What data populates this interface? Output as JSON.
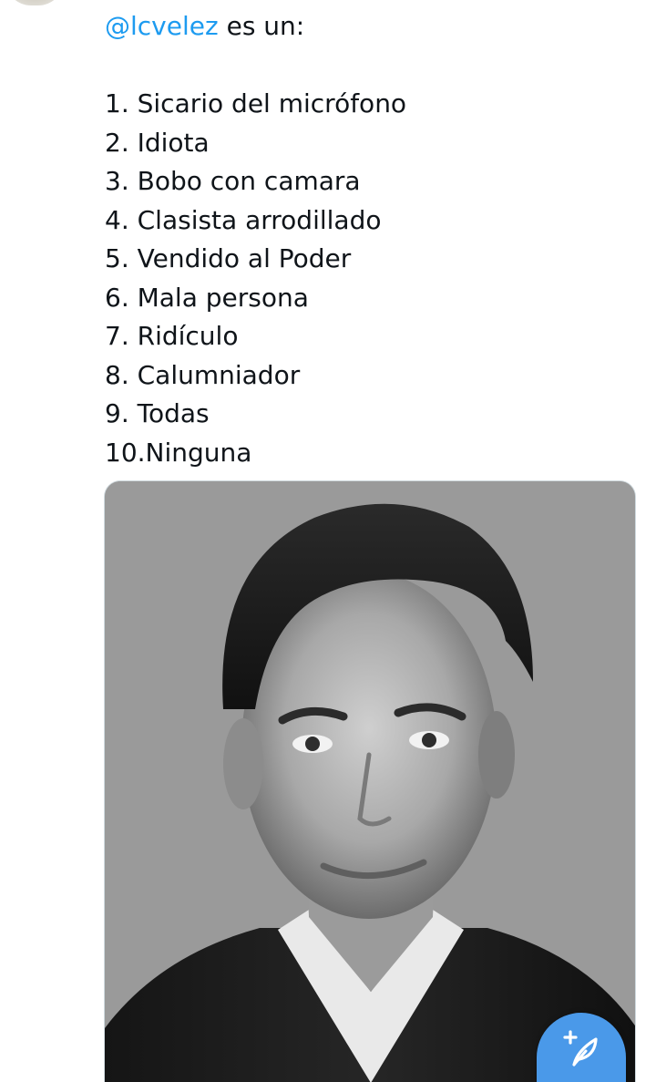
{
  "tweet": {
    "mention": "@lcvelez",
    "intro_rest": " es un:",
    "items": [
      "1. Sicario del micrófono",
      "2. Idiota",
      "3. Bobo con camara",
      "4. Clasista arrodillado",
      "5. Vendido al Poder",
      "6. Mala persona",
      "7. Ridículo",
      "8. Calumniador",
      "9. Todas",
      "10.Ninguna"
    ]
  },
  "colors": {
    "mention": "#1d9bf0",
    "fab": "#4a99e9"
  },
  "icons": {
    "fab": "compose-plus-feather-icon"
  }
}
